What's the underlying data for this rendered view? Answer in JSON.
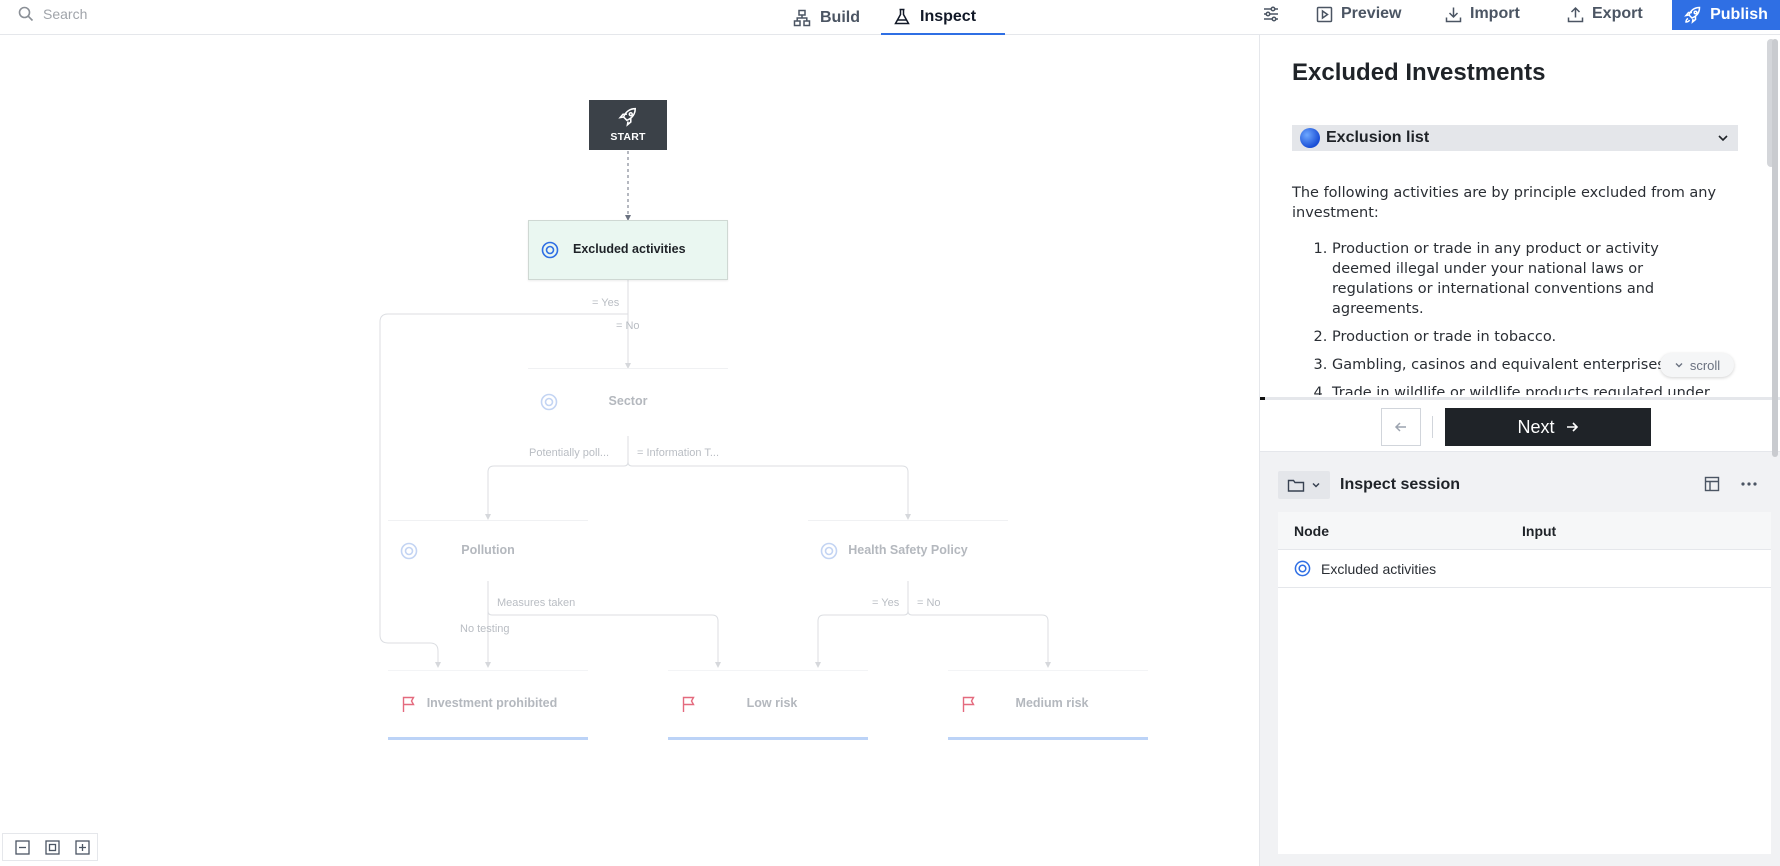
{
  "search": {
    "placeholder": "Search"
  },
  "tabs": [
    {
      "label": "Build",
      "icon": "sitemap-icon",
      "active": false
    },
    {
      "label": "Inspect",
      "icon": "flask-icon",
      "active": true
    }
  ],
  "toolbar": {
    "settings_icon": "sliders-icon",
    "preview_label": "Preview",
    "import_label": "Import",
    "export_label": "Export",
    "publish_label": "Publish"
  },
  "colors": {
    "accent": "#2f6fe4",
    "start_node": "#3b4148",
    "active_node_bg": "#eaf7f1",
    "flag": "#e46a7e",
    "outcome_bar": "#bcd3f7"
  },
  "flow": {
    "start_label": "START",
    "nodes": [
      {
        "id": "excluded",
        "label": "Excluded activities",
        "active": true
      },
      {
        "id": "sector",
        "label": "Sector"
      },
      {
        "id": "pollution",
        "label": "Pollution"
      },
      {
        "id": "health",
        "label": "Health Safety Policy"
      },
      {
        "id": "prohibited",
        "label": "Investment prohibited",
        "outcome": true
      },
      {
        "id": "low",
        "label": "Low risk",
        "outcome": true
      },
      {
        "id": "medium",
        "label": "Medium risk",
        "outcome": true
      }
    ],
    "edge_labels": {
      "yes1": "= Yes",
      "no1": "= No",
      "potentially": "Potentially poll...",
      "information": "= Information T...",
      "measures": "Measures taken",
      "no_testing": "No testing",
      "yes2": "= Yes",
      "no2": "= No"
    }
  },
  "zoom_controls": [
    "zoom-out",
    "fit",
    "zoom-in"
  ],
  "document": {
    "title": "Excluded Investments",
    "section_label": "Exclusion list",
    "intro": "The following activities are by principle excluded from any investment:",
    "items": [
      "Production or trade in any product or activity deemed illegal under your national laws or regulations or international conventions and agreements.",
      "Production or trade in tobacco.",
      "Gambling, casinos and equivalent enterprises.",
      "Trade in wildlife or wildlife products regulated under"
    ],
    "scroll_hint": "scroll",
    "progress": 0.01
  },
  "navigation": {
    "next_label": "Next"
  },
  "session": {
    "title": "Inspect session",
    "columns": [
      "Node",
      "Input"
    ],
    "rows": [
      {
        "node": "Excluded activities",
        "input": ""
      }
    ]
  }
}
